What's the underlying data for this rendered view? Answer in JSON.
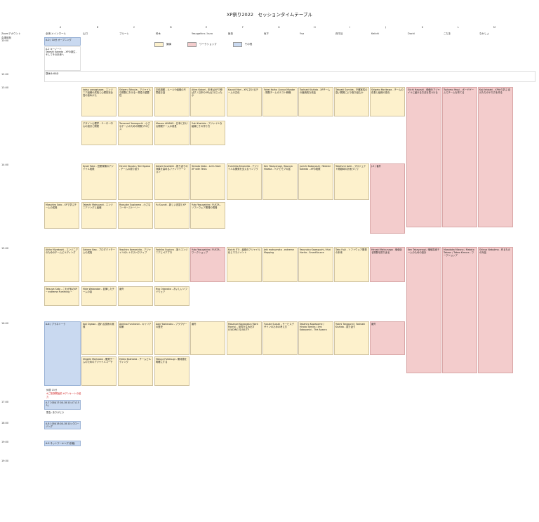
{
  "page": {
    "title": "XP祭り2022　セッションタイムテーブル"
  },
  "legend": [
    {
      "label": "講演",
      "color": "#fdf1cc"
    },
    {
      "label": "ワークショップ",
      "color": "#f3cccc"
    },
    {
      "label": "その他",
      "color": "#c9d9f0"
    }
  ],
  "header": {
    "room_label": "Zoomアカウント",
    "time_label": "会場時刻",
    "main_label": "全体/メインホール",
    "cols": [
      "A",
      "B",
      "C",
      "D",
      "E",
      "F",
      "G",
      "H",
      "I",
      "J",
      "K",
      "L",
      "M"
    ],
    "rooms": [
      "",
      "山口",
      "ブルーレ",
      "鈴木",
      "Yasugahira / kuro",
      "飯島",
      "坂下",
      "Ysa",
      "西平谷",
      "Keiichi",
      "Dochi",
      "こだま",
      "なかしょ"
    ]
  },
  "times": [
    "10:00",
    "10:50",
    "11:00",
    "12:00",
    "13:00",
    "13:50",
    "14:00",
    "14:50",
    "15:00",
    "16:00",
    "17:00",
    "18:00",
    "19:00",
    "19:30"
  ],
  "main": {
    "opening": "A-0 / 10分 オープニング",
    "keynote_title": "A-2 キーノート",
    "keynote_talk": "Takeshi Kakeda - XPの誕生 - そしてその未来へ",
    "lunch": "昼休み 60分",
    "a1": "Jumpei Hoshino - 現実を知ってチームが変わる、他人と振り返りを続けるには？",
    "a6": "A-6 / プラネトーク",
    "a7": "A-7 クロージング",
    "a8": "A-8 エンディング",
    "a9": "A-9 ネットワーキング / 懇親会",
    "note_red": "※ご挨拶開始前 ※アンケートの協力"
  },
  "sessions": [
    {
      "col": "B",
      "slot": "r1",
      "id": "B-1",
      "text": "katsu yanagisawa - エンジニア組織の成長と心理的安全性の高めかた"
    },
    {
      "col": "C",
      "slot": "r1",
      "id": "C-1",
      "text": "Shigeru Tatsuta - アジャイルな開発における一貫性の重要性"
    },
    {
      "col": "D",
      "slot": "r1",
      "id": "D-1",
      "text": "中嶋雄樹 - ルールや組織の不思議な話"
    },
    {
      "col": "E",
      "slot": "r1",
      "id": "E-1",
      "text": "Akira Kobori - 未来はXPで伸ばす / 日本のXPはどうだったか"
    },
    {
      "col": "F",
      "slot": "r1",
      "id": "F-1",
      "text": "Kazuki Mori - XPにおけるチームの文化"
    },
    {
      "col": "G",
      "slot": "r1",
      "id": "G-1",
      "text": "Yohei Kaiho / Junya Miyabe - 開発チームのテスト戦略"
    },
    {
      "col": "H",
      "slot": "r1",
      "id": "H-1",
      "text": "Toshiaki Kishida - XPチームの継続的な改善"
    },
    {
      "col": "I",
      "slot": "r1",
      "id": "I-1",
      "text": "Takaaki Sumida - 不確実性の高い開発にどう取り組むか"
    },
    {
      "col": "J",
      "slot": "r1",
      "id": "J-1",
      "text": "Shigeto Morikawa - チームの成長と組織の変化"
    },
    {
      "col": "K",
      "slot": "r1",
      "id": "K-1",
      "text": "Eiichi Hayashi - 価値をアジャイルに届ける方法を見つける"
    },
    {
      "col": "L",
      "slot": "r1",
      "id": "L-1",
      "text": "Tsutomu Yasui - ボードゲームでチームを育てる"
    },
    {
      "col": "M",
      "slot": "r1",
      "id": "M-1",
      "text": "Koji Ishizaki - XPから学ぶ 自分たちのやり方を作る"
    },
    {
      "col": "B",
      "slot": "r2",
      "id": "B-2",
      "text": "デザイン心理学 - ユーザー中心の設計と開発"
    },
    {
      "col": "C",
      "slot": "r2",
      "id": "C-2",
      "text": "Tomonori Yamaguchi - 小さなチームのための開発プロセス"
    },
    {
      "col": "D",
      "slot": "r2",
      "id": "D-2",
      "text": "Masaru AMANO - 日本における開発チームの成長"
    },
    {
      "col": "E",
      "slot": "r2",
      "id": "E-2",
      "text": "Yuki Kushida - アジャイルな組織とその作り方"
    },
    {
      "col": "B",
      "slot": "r3",
      "id": "B-3",
      "text": "Kyoei Tobe - 営業現場のアジャイル実践"
    },
    {
      "col": "C",
      "slot": "r3",
      "id": "C-3",
      "text": "Hiromi Yasuda / Kei Ogawa - チームの振り返り"
    },
    {
      "col": "D",
      "slot": "r3",
      "id": "D-3",
      "text": "Daishi Kushibiki - 振り返りの効果を高めるファシリテーション"
    },
    {
      "col": "E",
      "slot": "r3",
      "id": "E-3",
      "text": "Yamato Naka - Let's Start XP with Tests"
    },
    {
      "col": "F",
      "slot": "r3",
      "id": "F-3",
      "text": "Fumihiko Kinoshita - アジャイルな開発を支えるインフラ"
    },
    {
      "col": "G",
      "slot": "r3",
      "id": "G-3",
      "text": "Ken Takayanagi / Kazuya Hidaka - ペアとモブの話"
    },
    {
      "col": "H",
      "slot": "r3",
      "id": "H-3",
      "text": "Junichi Kobayashi / Takeshi Kakeda - XPの実践"
    },
    {
      "col": "I",
      "slot": "r3",
      "id": "I-3",
      "text": "Takefumi Iseki - プロジェクト開始時の計画づくり"
    },
    {
      "col": "J",
      "slot": "r3",
      "id": "J-3",
      "text": "J-3 / 番外"
    },
    {
      "col": "B",
      "slot": "r4",
      "id": "B-4",
      "text": "Takeshi Matsuzaki - エンジニアリングと組織"
    },
    {
      "col": "C",
      "slot": "r4",
      "id": "C-4",
      "text": "Ryosuke Sugiyama - 小さなユーザーストーリー"
    },
    {
      "col": "D",
      "slot": "r4",
      "id": "D-4",
      "text": "Yu Suzuki - 新しい言語とXP"
    },
    {
      "col": "E",
      "slot": "r4",
      "id": "E-4",
      "text": "Yuta Yasugahira / FUSTA - ソフトウェア開発の現場"
    },
    {
      "col": "A",
      "slot": "r4",
      "id": "A-4",
      "text": "Masahiro Sato - XPで学ぶチームの成長"
    },
    {
      "col": "B",
      "slot": "r5",
      "id": "B-5",
      "text": "Sakana Nao - プロダクトチームの成長"
    },
    {
      "col": "C",
      "slot": "r5",
      "id": "C-5",
      "text": "Yasuhiro Komoshita - アジャイルのレトロスペクティブ"
    },
    {
      "col": "D",
      "slot": "r5",
      "id": "D-5",
      "text": "Yoshiko Sugiura - 新人エンジニアとペアプロ"
    },
    {
      "col": "E",
      "slot": "r5",
      "id": "E-5",
      "text": "Yuta Yasugahira / FUSTA - ワークショップ"
    },
    {
      "col": "F",
      "slot": "r5",
      "id": "F-5",
      "text": "Koichi ITO - 組織のアジャイル化とマネジメント"
    },
    {
      "col": "G",
      "slot": "r5",
      "id": "G-5",
      "text": "Jeki matsumoto - extreme Mapping"
    },
    {
      "col": "H",
      "slot": "r5",
      "id": "H-5",
      "text": "Yasunobu Kawaguchi / Yuki Harita - SmartSource"
    },
    {
      "col": "I",
      "slot": "r5",
      "id": "I-5",
      "text": "Taku Fujii - ソフトウェア開発の未来"
    },
    {
      "col": "J",
      "slot": "r5",
      "id": "J-5",
      "text": "Hiroaki Matsunaga - 価値ある開発を振り返る"
    },
    {
      "col": "K",
      "slot": "r5",
      "id": "K-5",
      "text": "Ken Takayanagi / 価値探索チームのための設計"
    },
    {
      "col": "L",
      "slot": "r5",
      "id": "L-5",
      "text": "Masataka Mizuno / Makoto Takasu / Takeo Kimura - ワークショップ"
    },
    {
      "col": "M",
      "slot": "r5",
      "id": "M-5",
      "text": "Shinya Nakajima - 作るものの対話"
    },
    {
      "col": "A",
      "slot": "r5",
      "id": "A-5",
      "text": "Akiko Miyakoshi - エンジニアのためのチームビルディング"
    },
    {
      "col": "A",
      "slot": "r6",
      "id": "A-6",
      "text": "Tetsuya Sato - これが私のXP ~ extreme Pumming ~"
    },
    {
      "col": "B",
      "slot": "r6",
      "id": "B-6",
      "text": "Hide Watanabe - 自律したチームの話"
    },
    {
      "col": "C",
      "slot": "r6",
      "id": "C-6",
      "text": "番外"
    },
    {
      "col": "D",
      "slot": "r6",
      "id": "D-6",
      "text": "Ryo Odanaka - おいしいソフトウェア"
    },
    {
      "col": "B",
      "slot": "r7",
      "id": "B-7",
      "text": "Koji Ogawa - 語れる技術の実践"
    },
    {
      "col": "C",
      "slot": "r7",
      "id": "C-7",
      "text": "Akihisa Furuhashi - キャリア構築"
    },
    {
      "col": "D",
      "slot": "r7",
      "id": "D-7",
      "text": "Aoki Yoshinobu - ブラウザーの歴史"
    },
    {
      "col": "E",
      "slot": "r7",
      "id": "E-7",
      "text": "番外"
    },
    {
      "col": "F",
      "slot": "r7",
      "id": "F-7",
      "text": "Masanori Kawarada (Mark Morris) - 品質を生み出すLEADING QUALITY"
    },
    {
      "col": "G",
      "slot": "r7",
      "id": "G-7",
      "text": "Yusuke Suzuki - サービスデザインのための考え方"
    },
    {
      "col": "H",
      "slot": "r7",
      "id": "H-7",
      "text": "Takahiro Kawasome / Hiroko Tomita / Jimi Kobayashi - The Aozora"
    },
    {
      "col": "I",
      "slot": "r7",
      "id": "I-7",
      "text": "Yoichi Taniguchi / Toshiaki Kishida - 振り返り"
    },
    {
      "col": "J",
      "slot": "r7",
      "id": "J-7",
      "text": "番外"
    },
    {
      "col": "B",
      "slot": "r8",
      "id": "B-8",
      "text": "Shigeki Morizawa - 開発チームのためのアジャイルコーチ"
    },
    {
      "col": "C",
      "slot": "r8",
      "id": "C-8",
      "text": "Hideo Kashioka - チームビルディング"
    },
    {
      "col": "D",
      "slot": "r8",
      "id": "D-8",
      "text": "Takuya Futatsugi - 期待値を明確にする"
    }
  ],
  "breaks": {
    "b15": "休憩 15分",
    "b5": "休憩 5分",
    "b20": "休憩 20分"
  },
  "extra_times": [
    "17:00",
    "18:00",
    "19:00",
    "19:30"
  ],
  "closing": {
    "a7b": "A-7 20分(17:00-18:10) LT (15人)",
    "a8b": "A-8 10分(18:00-18:10) クロージング",
    "network": "A-9 ネットワーキング(引継)",
    "kaikai": "閉会: ありがとう"
  }
}
